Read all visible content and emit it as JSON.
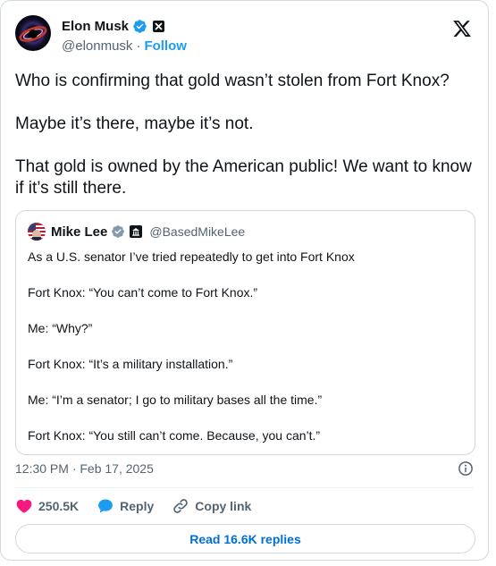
{
  "author": {
    "display_name": "Elon Musk",
    "handle": "@elonmusk",
    "separator": "·",
    "follow_label": "Follow"
  },
  "tweet": {
    "text": "Who is confirming that gold wasn’t stolen from Fort Knox?\n\nMaybe it’s there, maybe it’s not.\n\nThat gold is owned by the American public! We want to know if it’s still there.",
    "timestamp": "12:30 PM · Feb 17, 2025"
  },
  "quote": {
    "display_name": "Mike Lee",
    "handle": "@BasedMikeLee",
    "paragraphs": [
      "As a U.S. senator I’ve tried repeatedly to get into Fort Knox",
      "Fort Knox: “You can’t come to Fort Knox.”",
      "Me: “Why?”",
      "Fort Knox: “It’s a military installation.”",
      "Me: “I’m a senator; I go to military bases all the time.”",
      "Fort Knox: “You still can’t come. Because, you can’t.”"
    ]
  },
  "actions": {
    "likes": "250.5K",
    "reply_label": "Reply",
    "copy_link_label": "Copy link"
  },
  "read_replies_label": "Read 16.6K replies",
  "colors": {
    "accent": "#1d9bf0",
    "like": "#f91880",
    "verified": "#1d9bf0",
    "quote_verified": "#829aab",
    "border": "#cfd9de",
    "muted": "#536471"
  }
}
